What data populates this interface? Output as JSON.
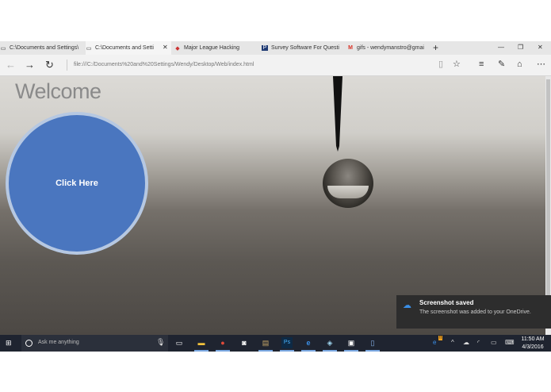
{
  "tabs": [
    {
      "label": "C:\\Documents and Settings\\",
      "icon": "page-icon",
      "active": false
    },
    {
      "label": "C:\\Documents and Setti",
      "icon": "page-icon",
      "active": true
    },
    {
      "label": "Major League Hacking",
      "icon": "mlh-icon",
      "active": false
    },
    {
      "label": "Survey Software For Questi",
      "icon": "surveymonkey-icon",
      "active": false
    },
    {
      "label": "gifs - wendymanstro@gmai",
      "icon": "gmail-icon",
      "active": false
    }
  ],
  "address": {
    "url": "file:///C:/Documents%20and%20Settings/Wendy/Desktop/Web/index.html"
  },
  "page": {
    "heading": "Welcome",
    "button_label": "Click Here"
  },
  "notification": {
    "title": "Screenshot saved",
    "body": "The screenshot was added to your OneDrive."
  },
  "taskbar": {
    "search_placeholder": "Ask me anything",
    "time": "11:50 AM",
    "date": "4/3/2016"
  },
  "colors": {
    "accent": "#4a76bf",
    "button_ring": "#b6c8e2",
    "taskbar": "#1f2430"
  }
}
